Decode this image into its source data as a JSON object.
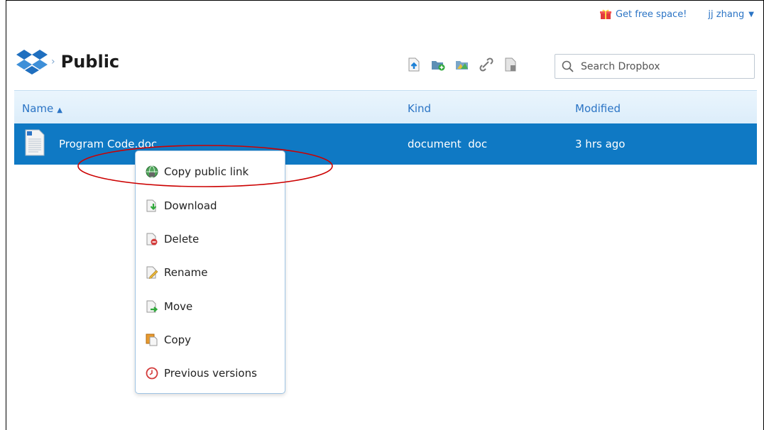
{
  "topbar": {
    "promo_label": "Get free space!",
    "user_name": "jj zhang",
    "caret": "▼"
  },
  "breadcrumb": {
    "separator": "›",
    "title": "Public"
  },
  "toolbar": {
    "icons": [
      "upload-icon",
      "new-folder-icon",
      "new-shared-folder-icon",
      "share-link-icon",
      "show-deleted-icon"
    ]
  },
  "search": {
    "placeholder": "Search Dropbox"
  },
  "columns": {
    "name": "Name",
    "sort_arrow": "▲",
    "kind": "Kind",
    "modified": "Modified"
  },
  "files": [
    {
      "name": "Program Code.doc",
      "kind": "document  doc",
      "modified": "3 hrs ago"
    }
  ],
  "context_menu": {
    "items": [
      {
        "label": "Copy public link",
        "icon": "public-link-icon"
      },
      {
        "label": "Download",
        "icon": "download-icon"
      },
      {
        "label": "Delete",
        "icon": "delete-icon"
      },
      {
        "label": "Rename",
        "icon": "rename-icon"
      },
      {
        "label": "Move",
        "icon": "move-icon"
      },
      {
        "label": "Copy",
        "icon": "copy-icon"
      },
      {
        "label": "Previous versions",
        "icon": "clock-icon"
      }
    ]
  },
  "colors": {
    "accent": "#2b74c5",
    "selected_row": "#0f79c4",
    "annotation": "#cc0000"
  }
}
